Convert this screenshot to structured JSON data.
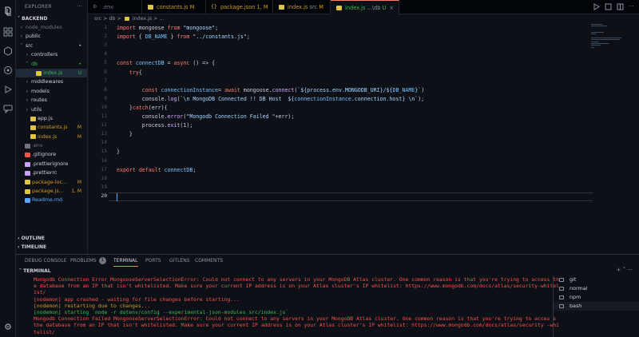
{
  "explorer": {
    "title": "EXPLORER",
    "root": "BACKEND",
    "tree": [
      {
        "label": "node_modules",
        "type": "folder",
        "depth": 1,
        "open": false,
        "color": "#6e7681"
      },
      {
        "label": "public",
        "type": "folder",
        "depth": 1,
        "open": false,
        "color": "#c9d1d9"
      },
      {
        "label": "src",
        "type": "folder",
        "depth": 1,
        "open": true,
        "color": "#c9d1d9",
        "badge": "",
        "badge_color": "#d29922",
        "dot": true
      },
      {
        "label": "controllers",
        "type": "folder",
        "depth": 2,
        "open": false,
        "color": "#c9d1d9"
      },
      {
        "label": "db",
        "type": "folder",
        "depth": 2,
        "open": true,
        "color": "#3fb950",
        "dot": true
      },
      {
        "label": "index.js",
        "type": "js",
        "depth": 3,
        "color": "#3fb950",
        "badge": "U",
        "badge_color": "#3fb950",
        "selected": true
      },
      {
        "label": "middlewares",
        "type": "folder",
        "depth": 2,
        "open": false,
        "color": "#c9d1d9"
      },
      {
        "label": "models",
        "type": "folder",
        "depth": 2,
        "open": false,
        "color": "#c9d1d9"
      },
      {
        "label": "routes",
        "type": "folder",
        "depth": 2,
        "open": false,
        "color": "#c9d1d9"
      },
      {
        "label": "utils",
        "type": "folder",
        "depth": 2,
        "open": false,
        "color": "#c9d1d9"
      },
      {
        "label": "app.js",
        "type": "js",
        "depth": 2,
        "color": "#c9d1d9"
      },
      {
        "label": "constants.js",
        "type": "js",
        "depth": 2,
        "color": "#d29922",
        "badge": "M",
        "badge_color": "#d29922"
      },
      {
        "label": "index.js",
        "type": "js",
        "depth": 2,
        "color": "#d29922",
        "badge": "M",
        "badge_color": "#d29922"
      },
      {
        "label": ".env",
        "type": "env",
        "depth": 1,
        "color": "#6e7681"
      },
      {
        "label": ".gitignore",
        "type": "git",
        "depth": 1,
        "color": "#c9d1d9"
      },
      {
        "label": ".prettierignore",
        "type": "cfg",
        "depth": 1,
        "color": "#c9d1d9"
      },
      {
        "label": ".prettierrc",
        "type": "cfg",
        "depth": 1,
        "color": "#c9d1d9"
      },
      {
        "label": "package-loc...",
        "type": "json",
        "depth": 1,
        "color": "#d29922",
        "badge": "M",
        "badge_color": "#d29922"
      },
      {
        "label": "package.js...",
        "type": "json",
        "depth": 1,
        "color": "#d29922",
        "badge": "1, M",
        "badge_color": "#d29922"
      },
      {
        "label": "Readme.md",
        "type": "md",
        "depth": 1,
        "color": "#58a6ff"
      }
    ],
    "outline": "OUTLINE",
    "timeline": "TIMELINE"
  },
  "tabs": [
    {
      "label": ".env",
      "path": "",
      "mod": "",
      "icon": "env",
      "active": false,
      "color": "#6e7681"
    },
    {
      "label": "constants.js",
      "path": "",
      "mod": "M",
      "icon": "js",
      "active": false,
      "color": "#d29922"
    },
    {
      "label": "package.json",
      "path": "",
      "mod": "1, M",
      "icon": "json",
      "active": false,
      "color": "#d29922"
    },
    {
      "label": "index.js",
      "path": "src",
      "mod": "M",
      "icon": "js",
      "active": false,
      "color": "#d29922"
    },
    {
      "label": "index.js",
      "path": "...\\db",
      "mod": "U",
      "icon": "js",
      "active": true,
      "color": "#3fb950"
    }
  ],
  "breadcrumb": {
    "parts": [
      "src",
      "db",
      "index.js",
      "..."
    ],
    "sep": ">"
  },
  "editor": {
    "current_line": 20,
    "lines": [
      {
        "n": "1",
        "text": "import mongoose from \"mongoose\";"
      },
      {
        "n": "2",
        "text": "import { DB_NAME } from \"../constants.js\";"
      },
      {
        "n": "3",
        "text": ""
      },
      {
        "n": "4",
        "text": ""
      },
      {
        "n": "5",
        "text": "const connectDB = async () => {"
      },
      {
        "n": "6",
        "text": "    try{"
      },
      {
        "n": "7",
        "text": ""
      },
      {
        "n": "8",
        "text": "        const connectionInstance= await mongoose.connect(`${process.env.MONGODB_URI}/${DB_NAME}`)"
      },
      {
        "n": "9",
        "text": "        console.log(`\\n MongoDB Connected !! DB Host  ${connectionInstance.connection.host} \\n`);"
      },
      {
        "n": "10",
        "text": "    }catch(err){"
      },
      {
        "n": "11",
        "text": "        console.error(\"Mongodb Connection Failed \"+err);"
      },
      {
        "n": "12",
        "text": "        process.exit(1);"
      },
      {
        "n": "13",
        "text": "    }"
      },
      {
        "n": "14",
        "text": ""
      },
      {
        "n": "15",
        "text": "}"
      },
      {
        "n": "16",
        "text": ""
      },
      {
        "n": "17",
        "text": "export default connectDB;"
      },
      {
        "n": "18",
        "text": ""
      },
      {
        "n": "19",
        "text": ""
      },
      {
        "n": "20",
        "text": ""
      }
    ]
  },
  "panel": {
    "tabs": [
      {
        "label": "DEBUG CONSOLE",
        "active": false
      },
      {
        "label": "PROBLEMS",
        "count": "1",
        "active": false
      },
      {
        "label": "TERMINAL",
        "active": true
      },
      {
        "label": "PORTS",
        "active": false
      },
      {
        "label": "GITLENS",
        "active": false
      },
      {
        "label": "COMMENTS",
        "active": false
      }
    ],
    "terminal_title": "TERMINAL",
    "actions": "+ ˅ ···",
    "output": [
      {
        "text": "Mongodb Connection Error MongooseServerSelectionError: Could not connect to any servers in your MongoDB Atlas cluster. One common reason is that you're trying to access the database from an IP that isn't whitelisted. Make sure your current IP address is on your Atlas cluster's IP whitelist: https://www.mongodb.com/docs/atlas/security-whitelist/",
        "color": "red"
      },
      {
        "text": "[nodemon] app crashed - waiting for file changes before starting...",
        "color": "red"
      },
      {
        "text": "[nodemon] restarting due to changes...",
        "color": "yellow"
      },
      {
        "text": "[nodemon] starting `node -r dotenv/config --experimental-json-modules src/index.js`",
        "color": "green"
      },
      {
        "text": "Mongodb Connection Failed MongooseServerSelectionError: Could not connect to any servers in your MongoDB Atlas cluster. One common reason is that you're trying to acces s the database from an IP that isn't whitelisted. Make sure your current IP address is on your Atlas cluster's IP whitelist: https://www.mongodb.com/docs/atlas/security -whitelist/",
        "color": "red"
      }
    ],
    "terminals": [
      {
        "label": "git",
        "selected": false
      },
      {
        "label": "normal",
        "selected": false
      },
      {
        "label": "npm",
        "selected": false
      },
      {
        "label": "bash",
        "selected": true
      }
    ]
  },
  "colors": {
    "accent": "#f78166",
    "keyword": "#ff7b72",
    "string": "#a5d6ff",
    "function": "#d2a8ff",
    "variable": "#79c0ff"
  }
}
